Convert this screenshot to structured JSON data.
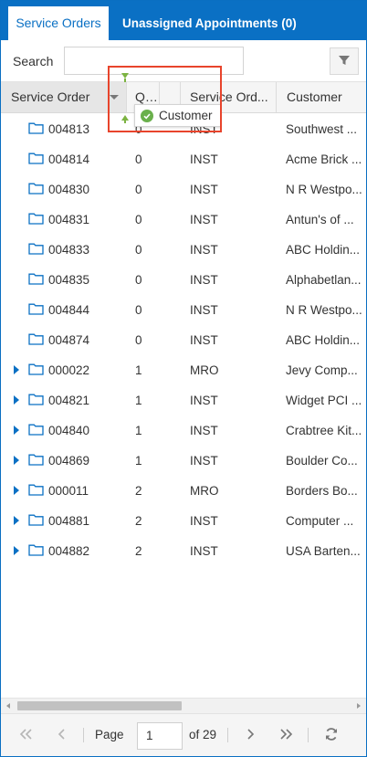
{
  "tabs": [
    {
      "label": "Service Orders",
      "active": true
    },
    {
      "label": "Unassigned Appointments (0)",
      "active": false
    }
  ],
  "toolbar": {
    "search_label": "Search",
    "search_value": "",
    "filter_icon": "filter-icon"
  },
  "columns": [
    "Service Order",
    "Qua",
    "Service Ord...",
    "Customer"
  ],
  "drag_tooltip": {
    "label": "Customer",
    "status_icon": "check-circle-icon"
  },
  "rows": [
    {
      "order": "004813",
      "qty": "0",
      "type": "INST",
      "customer": "Southwest ...",
      "expandable": false
    },
    {
      "order": "004814",
      "qty": "0",
      "type": "INST",
      "customer": "Acme Brick ...",
      "expandable": false
    },
    {
      "order": "004830",
      "qty": "0",
      "type": "INST",
      "customer": "N R Westpo...",
      "expandable": false
    },
    {
      "order": "004831",
      "qty": "0",
      "type": "INST",
      "customer": "Antun's of ...",
      "expandable": false
    },
    {
      "order": "004833",
      "qty": "0",
      "type": "INST",
      "customer": "ABC Holdin...",
      "expandable": false
    },
    {
      "order": "004835",
      "qty": "0",
      "type": "INST",
      "customer": "Alphabetlan...",
      "expandable": false
    },
    {
      "order": "004844",
      "qty": "0",
      "type": "INST",
      "customer": "N R Westpo...",
      "expandable": false
    },
    {
      "order": "004874",
      "qty": "0",
      "type": "INST",
      "customer": "ABC Holdin...",
      "expandable": false
    },
    {
      "order": "000022",
      "qty": "1",
      "type": "MRO",
      "customer": "Jevy Comp...",
      "expandable": true
    },
    {
      "order": "004821",
      "qty": "1",
      "type": "INST",
      "customer": "Widget PCI ...",
      "expandable": true
    },
    {
      "order": "004840",
      "qty": "1",
      "type": "INST",
      "customer": "Crabtree Kit...",
      "expandable": true
    },
    {
      "order": "004869",
      "qty": "1",
      "type": "INST",
      "customer": "Boulder Co...",
      "expandable": true
    },
    {
      "order": "000011",
      "qty": "2",
      "type": "MRO",
      "customer": "Borders Bo...",
      "expandable": true
    },
    {
      "order": "004881",
      "qty": "2",
      "type": "INST",
      "customer": "Computer ...",
      "expandable": true
    },
    {
      "order": "004882",
      "qty": "2",
      "type": "INST",
      "customer": "USA Barten...",
      "expandable": true
    }
  ],
  "pager": {
    "page_label": "Page",
    "page_value": "1",
    "of_label": "of 29"
  },
  "colors": {
    "accent": "#0a70c4",
    "highlight": "#e8442c",
    "drop_indicator": "#7cb342"
  }
}
